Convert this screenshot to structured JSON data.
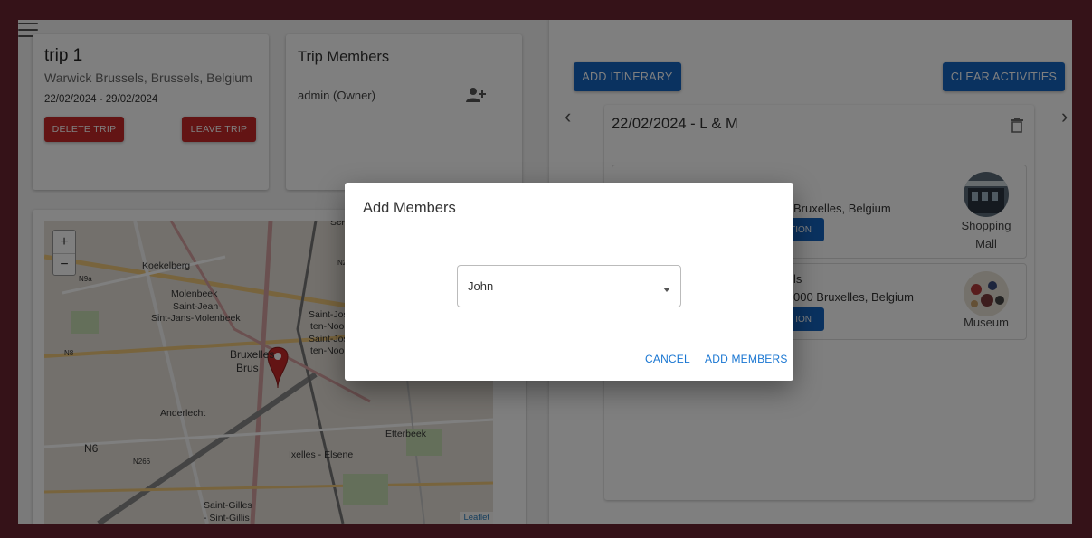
{
  "trip": {
    "title": "trip 1",
    "location": "Warwick Brussels, Brussels, Belgium",
    "dates": "22/02/2024 - 29/02/2024",
    "delete_label": "DELETE TRIP",
    "leave_label": "LEAVE TRIP"
  },
  "members": {
    "title": "Trip Members",
    "list": [
      "admin (Owner)"
    ]
  },
  "map": {
    "labels": [
      "Koekelberg",
      "N9a",
      "Molenbeek",
      "Saint-Jean",
      "Sint-Jans-Molenbeek",
      "Saint-Jos",
      "ten-Noo",
      "Saint-Jos",
      "ten-Noo",
      "N8",
      "Bruxelles",
      "Brus",
      "Anderlecht",
      "N6",
      "N266",
      "Etterbeek",
      "Ixelles - Elsene",
      "Saint-Gilles",
      "- Sint-Gillis",
      "Sch",
      "N2"
    ],
    "zoom_in": "+",
    "zoom_out": "−",
    "attribution": "Leaflet"
  },
  "itinerary": {
    "add_label": "ADD ITINERARY",
    "clear_label": "CLEAR ACTIVITIES",
    "day_title": "22/02/2024 - L & M",
    "activities": [
      {
        "line1": "Bruxelles, Belgium",
        "btn": "TION",
        "type_line1": "Shopping",
        "type_line2": "Mall"
      },
      {
        "line0": "ls",
        "line1": "000 Bruxelles, Belgium",
        "btn": "TION",
        "type_line1": "Museum"
      }
    ]
  },
  "dialog": {
    "title": "Add Members",
    "selected": "John",
    "cancel_label": "CANCEL",
    "confirm_label": "ADD MEMBERS"
  },
  "colors": {
    "accent": "#1565c0",
    "danger": "#c62828",
    "frame": "#6a2430"
  }
}
